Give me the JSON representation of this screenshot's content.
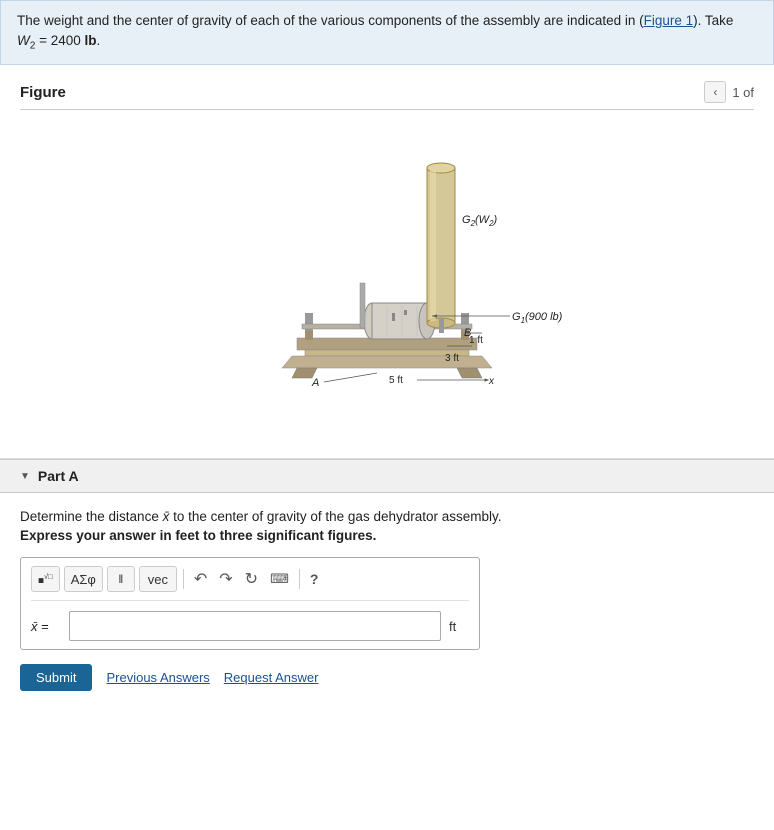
{
  "problem": {
    "statement": "The weight and the center of gravity of each of the various components of the assembly are indicated in (",
    "figure_link": "Figure 1",
    "statement_end": "). Take",
    "equation": "W₂ = 2400 lb",
    "banner_line2": "W₂ = 2400 lb."
  },
  "figure": {
    "title": "Figure",
    "nav_label": "1 of",
    "labels": {
      "G2W2": "G₂(W₂)",
      "G1": "G₁(900 lb)",
      "B": "B",
      "dim1": "3 ft",
      "dim2": "1 ft",
      "dim3": "5 ft",
      "x_axis": "x",
      "A": "A"
    }
  },
  "partA": {
    "toggle_icon": "▼",
    "label": "Part A",
    "question": "Determine the distance x̅ to the center of gravity of the gas dehydrator assembly.",
    "instruction": "Express your answer in feet to three significant figures.",
    "toolbar": {
      "fraction_btn": "■√□",
      "symbols_btn": "AΣφ",
      "matrix_btn": "‖",
      "vec_btn": "vec",
      "undo_icon": "↶",
      "redo_icon": "↷",
      "refresh_icon": "↻",
      "keyboard_icon": "…",
      "help_icon": "?"
    },
    "input": {
      "label": "x̅ =",
      "placeholder": "",
      "unit": "ft"
    },
    "buttons": {
      "submit": "Submit",
      "previous": "Previous Answers",
      "request": "Request Answer"
    }
  }
}
